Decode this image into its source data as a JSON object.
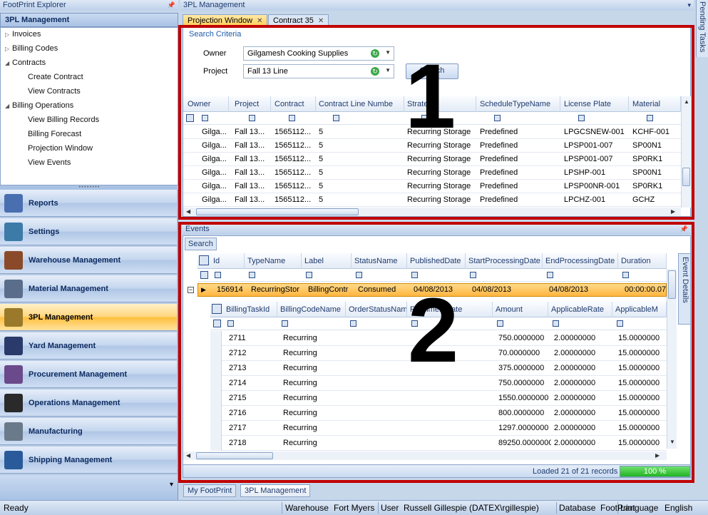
{
  "explorer": {
    "title": "FootPrint Explorer",
    "section": "3PL Management",
    "tree": [
      {
        "label": "Invoices",
        "arrow": "▷",
        "indent": 0
      },
      {
        "label": "Billing Codes",
        "arrow": "▷",
        "indent": 0
      },
      {
        "label": "Contracts",
        "arrow": "◢",
        "indent": 0
      },
      {
        "label": "Create Contract",
        "arrow": "",
        "indent": 1
      },
      {
        "label": "View Contracts",
        "arrow": "",
        "indent": 1
      },
      {
        "label": "Billing Operations",
        "arrow": "◢",
        "indent": 0
      },
      {
        "label": "View Billing Records",
        "arrow": "",
        "indent": 1
      },
      {
        "label": "Billing Forecast",
        "arrow": "",
        "indent": 1
      },
      {
        "label": "Projection Window",
        "arrow": "",
        "indent": 1
      },
      {
        "label": "View Events",
        "arrow": "",
        "indent": 1
      }
    ],
    "nav": [
      {
        "label": "Reports",
        "icon": "reports-icon",
        "color": "#4a6fb0"
      },
      {
        "label": "Settings",
        "icon": "settings-icon",
        "color": "#3c7aa8"
      },
      {
        "label": "Warehouse Management",
        "icon": "warehouse-icon",
        "color": "#8a4a2a"
      },
      {
        "label": "Material Management",
        "icon": "material-icon",
        "color": "#5a6e8c"
      },
      {
        "label": "3PL Management",
        "icon": "3pl-icon",
        "color": "#9a7a2a",
        "active": true
      },
      {
        "label": "Yard Management",
        "icon": "yard-icon",
        "color": "#2a3a6a"
      },
      {
        "label": "Procurement Management",
        "icon": "procurement-icon",
        "color": "#6a4a8a"
      },
      {
        "label": "Operations Management",
        "icon": "operations-icon",
        "color": "#2a2a2a"
      },
      {
        "label": "Manufacturing",
        "icon": "manufacturing-icon",
        "color": "#6a7a8a"
      },
      {
        "label": "Shipping Management",
        "icon": "shipping-icon",
        "color": "#2a5a9a"
      }
    ]
  },
  "main": {
    "title": "3PL Management",
    "tabs": [
      {
        "label": "Projection Window",
        "active": true
      },
      {
        "label": "Contract 35",
        "active": false
      }
    ],
    "pending": "Pending Tasks"
  },
  "criteria": {
    "title": "Search Criteria",
    "owner_label": "Owner",
    "owner_value": "Gilgamesh Cooking Supplies",
    "project_label": "Project",
    "project_value": "Fall 13 Line",
    "search_button": "Search"
  },
  "grid1": {
    "columns": [
      "Owner",
      "Project",
      "Contract",
      "Contract Line Numbe",
      "Strategy",
      "ScheduleTypeName",
      "License Plate",
      "Material"
    ],
    "rows": [
      [
        "Gilga...",
        "Fall 13...",
        "1565112...",
        "5",
        "Recurring Storage",
        "Predefined",
        "LPGCSNEW-001",
        "KCHF-001"
      ],
      [
        "Gilga...",
        "Fall 13...",
        "1565112...",
        "5",
        "Recurring Storage",
        "Predefined",
        "LPSP001-007",
        "SP00N1"
      ],
      [
        "Gilga...",
        "Fall 13...",
        "1565112...",
        "5",
        "Recurring Storage",
        "Predefined",
        "LPSP001-007",
        "SP0RK1"
      ],
      [
        "Gilga...",
        "Fall 13...",
        "1565112...",
        "5",
        "Recurring Storage",
        "Predefined",
        "LPSHP-001",
        "SP00N1"
      ],
      [
        "Gilga...",
        "Fall 13...",
        "1565112...",
        "5",
        "Recurring Storage",
        "Predefined",
        "LPSP00NR-001",
        "SP0RK1"
      ],
      [
        "Gilga...",
        "Fall 13...",
        "1565112...",
        "5",
        "Recurring Storage",
        "Predefined",
        "LPCHZ-001",
        "GCHZ"
      ]
    ]
  },
  "events": {
    "title": "Events",
    "search": "Search",
    "side_tab": "Event Details",
    "columns": [
      "Id",
      "TypeName",
      "Label",
      "StatusName",
      "PublishedDate",
      "StartProcessingDate",
      "EndProcessingDate",
      "Duration"
    ],
    "event_row": [
      "156914",
      "RecurringStor",
      "BillingContr",
      "Consumed",
      "04/08/2013",
      "04/08/2013",
      "04/08/2013",
      "00:00:00.07"
    ],
    "sub_columns": [
      "BillingTaskId",
      "BillingCodeName",
      "OrderStatusName",
      "FulfillmentDate",
      "Amount",
      "ApplicableRate",
      "ApplicableM"
    ],
    "sub_rows": [
      [
        "2711",
        "Recurring",
        "",
        "",
        "750.0000000",
        "2.00000000",
        "15.0000000"
      ],
      [
        "2712",
        "Recurring",
        "",
        "",
        "70.0000000",
        "2.00000000",
        "15.0000000"
      ],
      [
        "2713",
        "Recurring",
        "",
        "",
        "375.0000000",
        "2.00000000",
        "15.0000000"
      ],
      [
        "2714",
        "Recurring",
        "",
        "",
        "750.0000000",
        "2.00000000",
        "15.0000000"
      ],
      [
        "2715",
        "Recurring",
        "",
        "",
        "1550.0000000",
        "2.00000000",
        "15.0000000"
      ],
      [
        "2716",
        "Recurring",
        "",
        "",
        "800.0000000",
        "2.00000000",
        "15.0000000"
      ],
      [
        "2717",
        "Recurring",
        "",
        "",
        "1297.0000000",
        "2.00000000",
        "15.0000000"
      ],
      [
        "2718",
        "Recurring",
        "",
        "",
        "89250.0000000",
        "2.00000000",
        "15.0000000"
      ]
    ],
    "loaded": "Loaded 21 of 21 records",
    "progress": "100 %",
    "progress_value": 1.0
  },
  "annotations": [
    "1",
    "2"
  ],
  "bottom_tabs": [
    "My FootPrint",
    "3PL Management"
  ],
  "status": {
    "ready": "Ready",
    "warehouse_label": "Warehouse",
    "warehouse_value": "Fort Myers",
    "user_label": "User",
    "user_value": "Russell Gillespie (DATEX\\rgillespie)",
    "database_label": "Database",
    "database_value": "FootPrint",
    "language_label": "Language",
    "language_value": "English"
  }
}
